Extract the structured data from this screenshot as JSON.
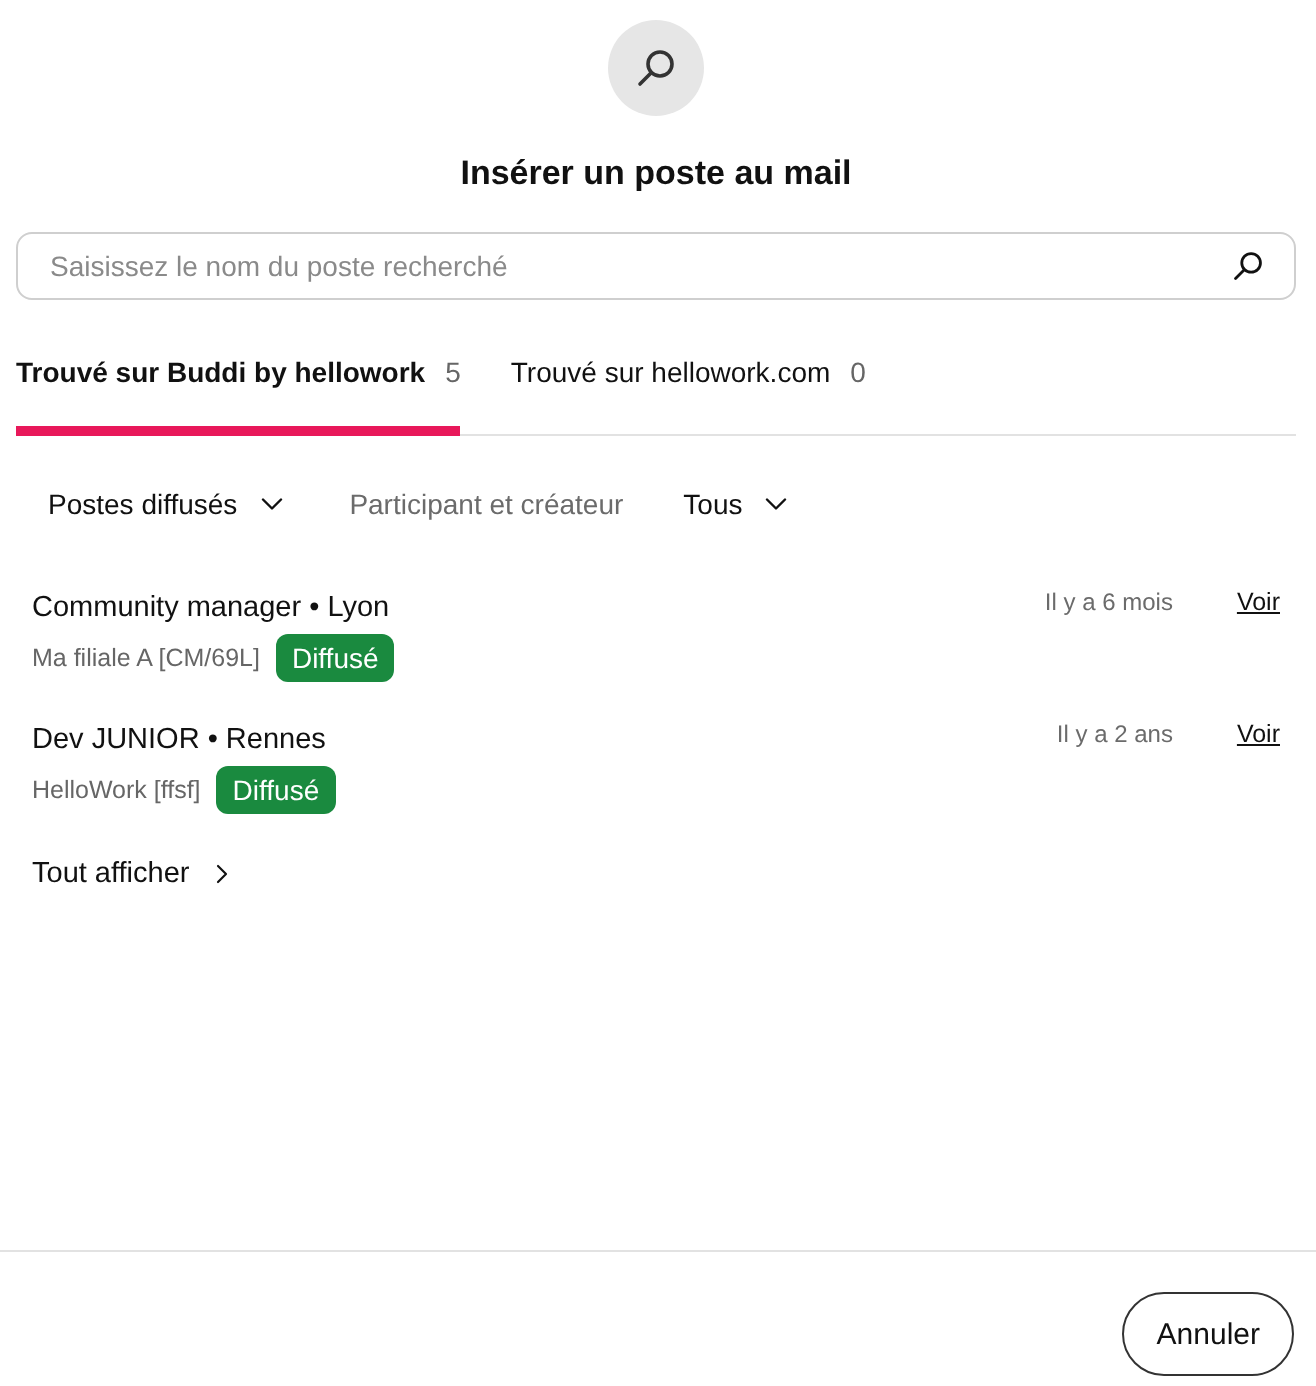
{
  "header": {
    "title": "Insérer un poste au mail"
  },
  "search": {
    "placeholder": "Saisissez le nom du poste recherché"
  },
  "tabs": [
    {
      "label": "Trouvé sur Buddi by hellowork",
      "count": "5",
      "selected": true
    },
    {
      "label": "Trouvé sur hellowork.com",
      "count": "0",
      "selected": false
    }
  ],
  "filters": [
    {
      "kind": "dropdown",
      "label": "Postes diffusés"
    },
    {
      "kind": "label",
      "label": "Participant et créateur"
    },
    {
      "kind": "dropdown",
      "label": "Tous"
    }
  ],
  "jobs": [
    {
      "title": "Community manager • Lyon",
      "company": "Ma filiale A [CM/69L]",
      "status": "Diffusé",
      "date": "Il y a 6 mois",
      "link": "Voir"
    },
    {
      "title": "Dev JUNIOR • Rennes",
      "company": "HelloWork [ffsf]",
      "status": "Diffusé",
      "date": "Il y a 2 ans",
      "link": "Voir"
    }
  ],
  "show_all": "Tout afficher",
  "footer": {
    "cancel": "Annuler"
  }
}
